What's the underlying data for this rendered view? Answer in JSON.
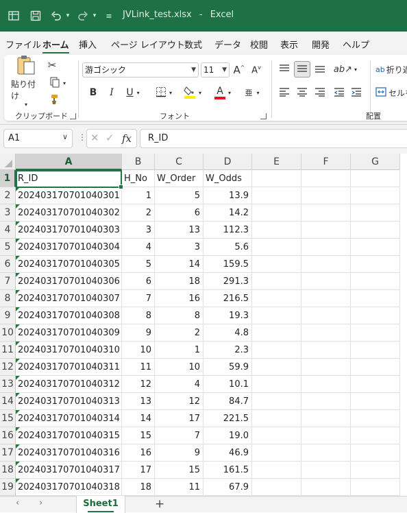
{
  "titlebar": {
    "filename": "JVLink_test.xlsx",
    "separator": "-",
    "app": "Excel"
  },
  "menu": {
    "tabs": [
      "ファイル",
      "ホーム",
      "挿入",
      "ページ レイアウト",
      "数式",
      "データ",
      "校閲",
      "表示",
      "開発",
      "ヘルプ"
    ],
    "active": "ホーム"
  },
  "ribbon": {
    "clipboard": {
      "paste_label": "貼り付け",
      "group_label": "クリップボード"
    },
    "font": {
      "font_name": "游ゴシック",
      "font_size": "11",
      "group_label": "フォント",
      "bold": "B",
      "italic": "I",
      "underline": "U",
      "grow": "A",
      "shrink": "A",
      "color": "A"
    },
    "alignment": {
      "wrap_label": "折り返",
      "merge_label": "セルを",
      "group_label": "配置"
    }
  },
  "formula_bar": {
    "name_box": "A1",
    "fx": "fx",
    "formula": "R_ID"
  },
  "columns": [
    "A",
    "B",
    "C",
    "D",
    "E",
    "F",
    "G"
  ],
  "rows": [
    {
      "n": "1",
      "a": "R_ID",
      "b": "H_No",
      "c": "W_Order",
      "d": "W_Odds"
    },
    {
      "n": "2",
      "a": "202403170701040301",
      "b": "1",
      "c": "5",
      "d": "13.9"
    },
    {
      "n": "3",
      "a": "202403170701040302",
      "b": "2",
      "c": "6",
      "d": "14.2"
    },
    {
      "n": "4",
      "a": "202403170701040303",
      "b": "3",
      "c": "13",
      "d": "112.3"
    },
    {
      "n": "5",
      "a": "202403170701040304",
      "b": "4",
      "c": "3",
      "d": "5.6"
    },
    {
      "n": "6",
      "a": "202403170701040305",
      "b": "5",
      "c": "14",
      "d": "159.5"
    },
    {
      "n": "7",
      "a": "202403170701040306",
      "b": "6",
      "c": "18",
      "d": "291.3"
    },
    {
      "n": "8",
      "a": "202403170701040307",
      "b": "7",
      "c": "16",
      "d": "216.5"
    },
    {
      "n": "9",
      "a": "202403170701040308",
      "b": "8",
      "c": "8",
      "d": "19.3"
    },
    {
      "n": "10",
      "a": "202403170701040309",
      "b": "9",
      "c": "2",
      "d": "4.8"
    },
    {
      "n": "11",
      "a": "202403170701040310",
      "b": "10",
      "c": "1",
      "d": "2.3"
    },
    {
      "n": "12",
      "a": "202403170701040311",
      "b": "11",
      "c": "10",
      "d": "59.9"
    },
    {
      "n": "13",
      "a": "202403170701040312",
      "b": "12",
      "c": "4",
      "d": "10.1"
    },
    {
      "n": "14",
      "a": "202403170701040313",
      "b": "13",
      "c": "12",
      "d": "84.7"
    },
    {
      "n": "15",
      "a": "202403170701040314",
      "b": "14",
      "c": "17",
      "d": "221.5"
    },
    {
      "n": "16",
      "a": "202403170701040315",
      "b": "15",
      "c": "7",
      "d": "19.0"
    },
    {
      "n": "17",
      "a": "202403170701040316",
      "b": "16",
      "c": "9",
      "d": "46.9"
    },
    {
      "n": "18",
      "a": "202403170701040317",
      "b": "17",
      "c": "15",
      "d": "161.5"
    },
    {
      "n": "19",
      "a": "202403170701040318",
      "b": "18",
      "c": "11",
      "d": "67.9"
    }
  ],
  "sheets": {
    "tab": "Sheet1",
    "add": "+"
  },
  "colors": {
    "excel_green": "#1e7145",
    "selection": "#217346",
    "error_triangle": "#1d7b3f"
  }
}
